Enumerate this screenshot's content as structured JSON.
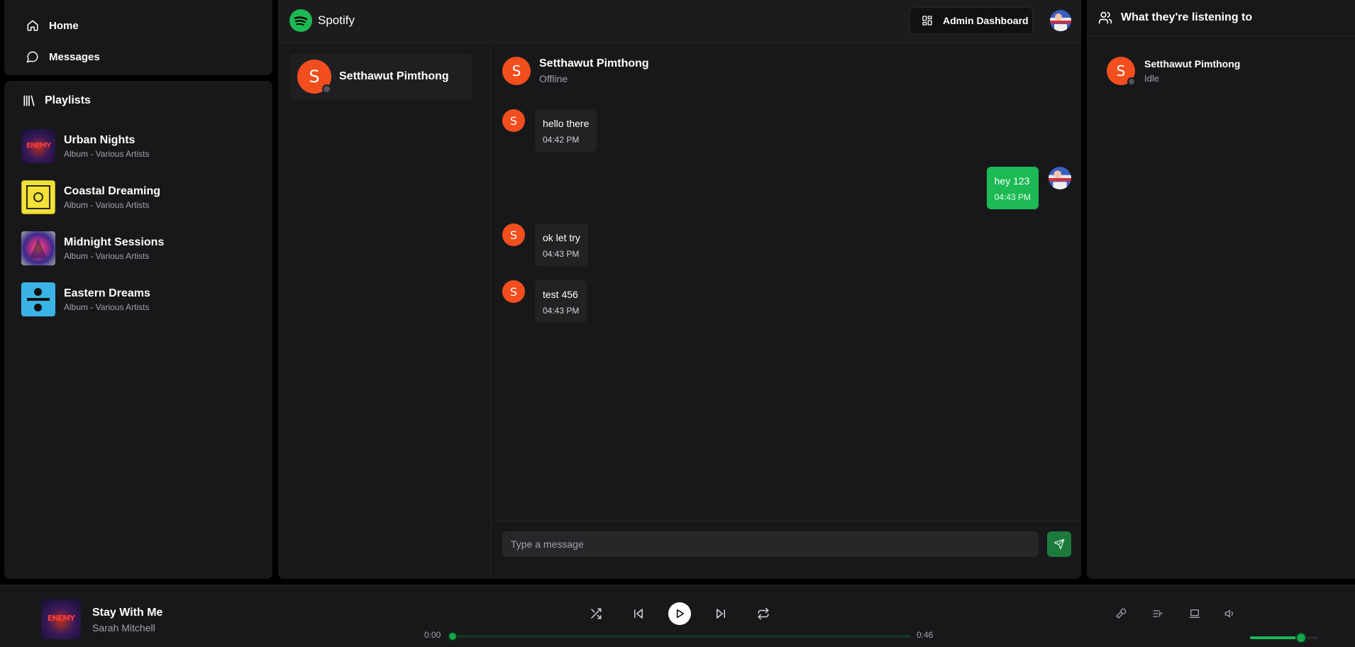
{
  "nav": {
    "home_label": "Home",
    "messages_label": "Messages"
  },
  "playlists": {
    "header": "Playlists",
    "items": [
      {
        "title": "Urban Nights",
        "subtitle": "Album - Various Artists",
        "art": "urban-nights-art"
      },
      {
        "title": "Coastal Dreaming",
        "subtitle": "Album - Various Artists",
        "art": "coastal-dreaming-art"
      },
      {
        "title": "Midnight Sessions",
        "subtitle": "Album - Various Artists",
        "art": "midnight-sessions-art"
      },
      {
        "title": "Eastern Dreams",
        "subtitle": "Album - Various Artists",
        "art": "eastern-dreams-art"
      }
    ]
  },
  "topbar": {
    "brand": "Spotify",
    "admin_label": "Admin Dashboard"
  },
  "conversations": [
    {
      "initial": "S",
      "name": "Setthawut Pimthong"
    }
  ],
  "chat": {
    "initial": "S",
    "name": "Setthawut Pimthong",
    "status": "Offline",
    "messages": [
      {
        "text": "hello there",
        "time": "04:42 PM",
        "from": "them"
      },
      {
        "text": "hey 123",
        "time": "04:43 PM",
        "from": "me"
      },
      {
        "text": "ok let try",
        "time": "04:43 PM",
        "from": "them"
      },
      {
        "text": "test 456",
        "time": "04:43 PM",
        "from": "them"
      }
    ],
    "input_placeholder": "Type a message"
  },
  "activity": {
    "header": "What they're listening to",
    "friends": [
      {
        "initial": "S",
        "name": "Setthawut Pimthong",
        "status": "Idle"
      }
    ]
  },
  "player": {
    "title": "Stay With Me",
    "artist": "Sarah Mitchell",
    "current_time": "0:00",
    "duration": "0:46",
    "progress": 0,
    "volume": 0.75
  },
  "colors": {
    "accent": "#1db954",
    "avatar": "#f24e1e",
    "background": "#18181b"
  }
}
